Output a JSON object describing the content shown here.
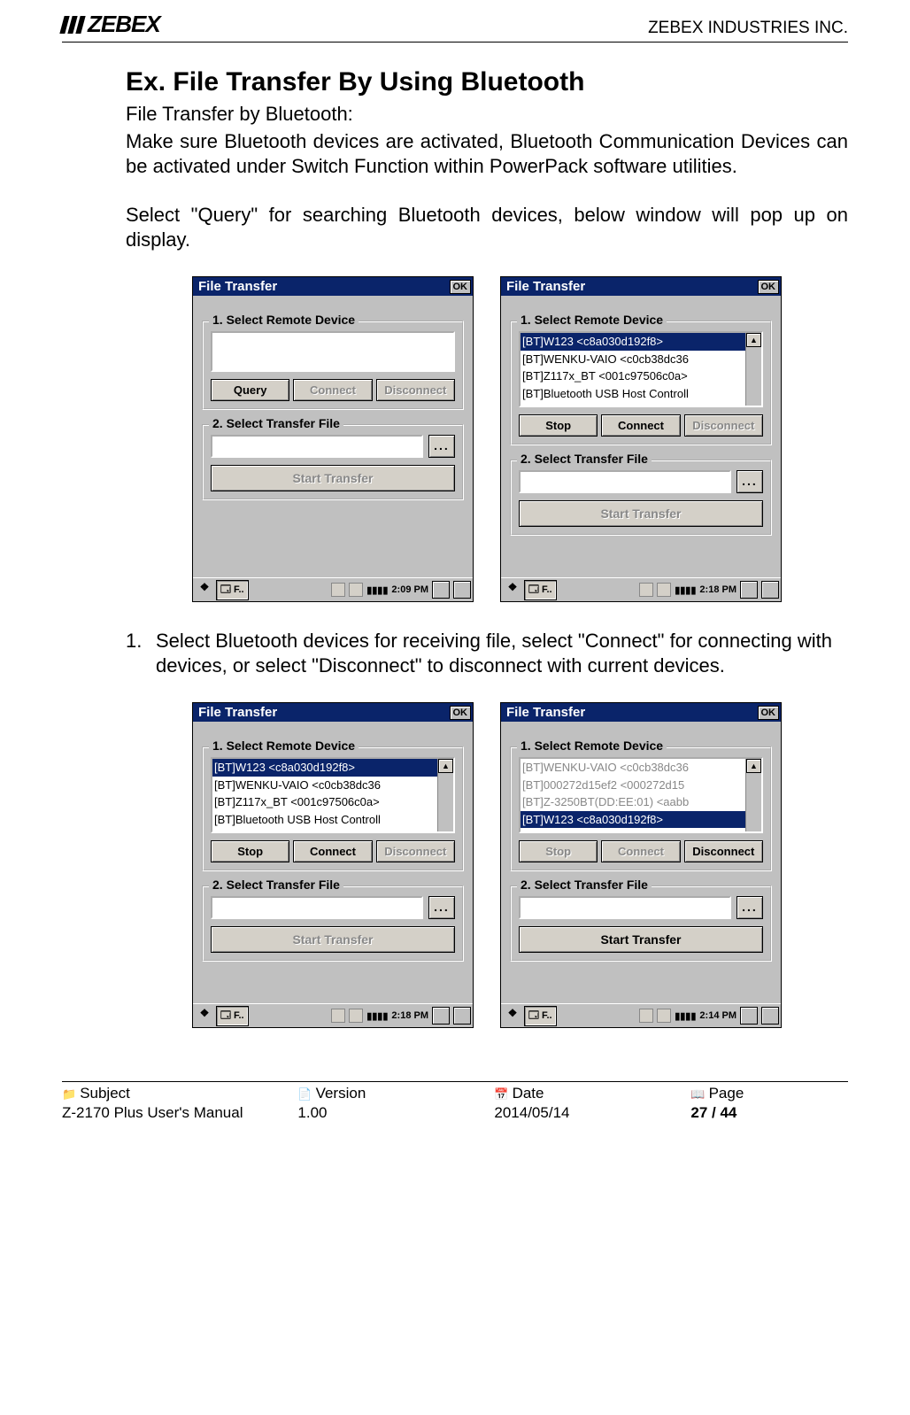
{
  "header": {
    "logo_text": "ZEBEX",
    "company": "ZEBEX INDUSTRIES INC."
  },
  "title": "Ex. File Transfer By Using Bluetooth",
  "subtitle": "File Transfer by Bluetooth:",
  "para1": "Make sure Bluetooth devices are activated, Bluetooth Communication Devices can be activated under Switch Function within PowerPack software utilities.",
  "para2": "Select \"Query\" for searching Bluetooth devices, below window will pop up on display.",
  "step1_num": "1.",
  "step1_text": "Select Bluetooth devices for receiving file, select \"Connect\" for connecting with devices, or select \"Disconnect\" to disconnect with current devices.",
  "shots": {
    "common": {
      "title": "File Transfer",
      "ok": "OK",
      "legend1": "1. Select Remote Device",
      "legend2": "2. Select Transfer File",
      "query": "Query",
      "stop": "Stop",
      "connect": "Connect",
      "disconnect": "Disconnect",
      "start_transfer": "Start Transfer",
      "browse": "...",
      "task_label": "F.."
    },
    "A1_time": "2:09 PM",
    "A2_time": "2:18 PM",
    "B1_time": "2:18 PM",
    "B2_time": "2:14 PM",
    "devices": {
      "d0": "[BT]W123 <c8a030d192f8>",
      "d1": "[BT]WENKU-VAIO <c0cb38dc36",
      "d2": "[BT]Z117x_BT <001c97506c0a>",
      "d3": "[BT]Bluetooth USB Host Controll",
      "g0": "[BT]WENKU-VAIO <c0cb38dc36",
      "g1": "[BT]000272d15ef2 <000272d15",
      "g2": "[BT]Z-3250BT(DD:EE:01) <aabb",
      "g3": "[BT]W123 <c8a030d192f8>"
    }
  },
  "footer": {
    "labels": {
      "subject": "Subject",
      "version": "Version",
      "date": "Date",
      "page": "Page"
    },
    "values": {
      "subject": "Z-2170 Plus User's Manual",
      "version": "1.00",
      "date": "2014/05/14",
      "page": "27 / 44"
    }
  }
}
